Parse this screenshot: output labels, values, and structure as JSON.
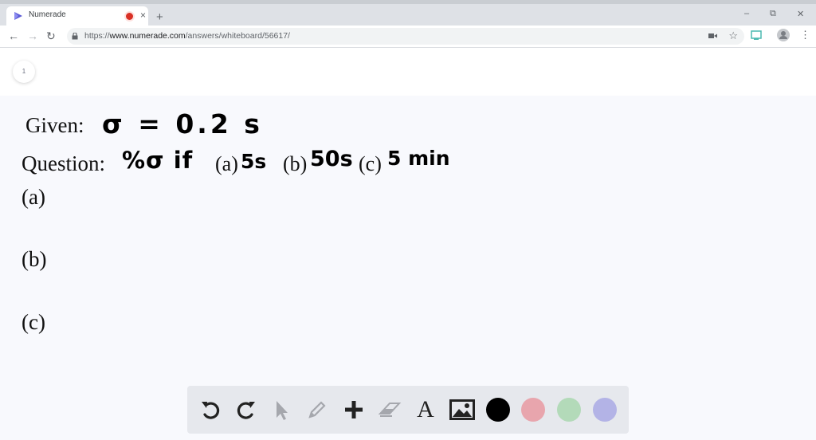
{
  "browser": {
    "tab_title": "Numerade",
    "url_prefix": "https://",
    "url_host": "www.numerade.com",
    "url_path": "/answers/whiteboard/56617/",
    "new_tab": "+",
    "close_tab": "×",
    "controls": {
      "minimize": "–",
      "restore": "⧉",
      "close": "✕"
    },
    "nav": {
      "back": "←",
      "forward": "→",
      "reload": "↻"
    },
    "star": "☆"
  },
  "page": {
    "page_number": "1"
  },
  "whiteboard": {
    "given_label": "Given:",
    "given_value": "σ = 0.2 s",
    "question_label": "Question:",
    "question_pct": "%σ if",
    "a_label": "(a)",
    "a_value": "5s",
    "b_label": "(b)",
    "b_value": "50s",
    "c_label": "(c)",
    "c_value": "5 min",
    "part_a": "(a)",
    "part_b": "(b)",
    "part_c": "(c)"
  },
  "toolbar": {
    "text_tool": "A",
    "tools": [
      "undo-icon",
      "redo-icon",
      "pointer-icon",
      "pencil-icon",
      "plus-icon",
      "eraser-icon",
      "text-icon",
      "image-icon"
    ],
    "colors": [
      "#000000",
      "#e8a5ad",
      "#b3dab9",
      "#b3b3e6"
    ]
  }
}
